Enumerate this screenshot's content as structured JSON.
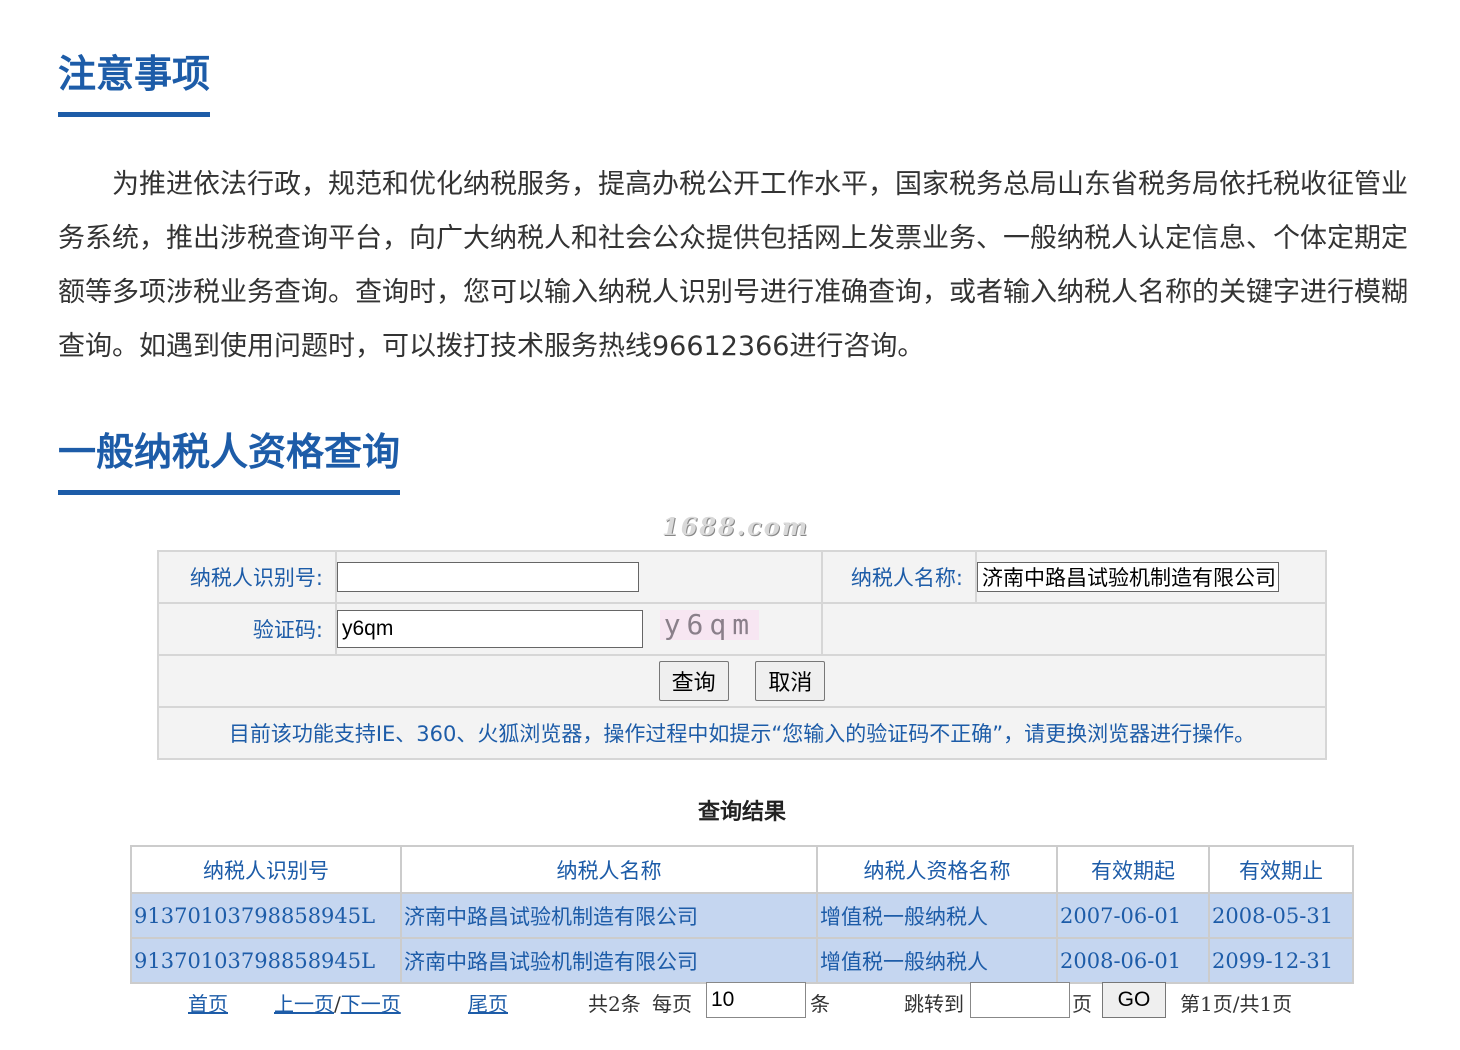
{
  "notice_section": {
    "title": "注意事项",
    "paragraph": "为推进依法行政，规范和优化纳税服务，提高办税公开工作水平，国家税务总局山东省税务局依托税收征管业务系统，推出涉税查询平台，向广大纳税人和社会公众提供包括网上发票业务、一般纳税人认定信息、个体定期定额等多项涉税业务查询。查询时，您可以输入纳税人识别号进行准确查询，或者输入纳税人名称的关键字进行模糊查询。如遇到使用问题时，可以拨打技术服务热线96612366进行咨询。"
  },
  "query_section": {
    "title": "一般纳税人资格查询",
    "watermark": "1688.com"
  },
  "form": {
    "taxpayer_id_label": "纳税人识别号:",
    "taxpayer_id_value": "",
    "taxpayer_name_label": "纳税人名称:",
    "taxpayer_name_value": "济南中路昌试验机制造有限公司",
    "captcha_label": "验证码:",
    "captcha_value": "y6qm",
    "captcha_image_text": "y6qm",
    "query_button": "查询",
    "cancel_button": "取消",
    "browser_notice": "目前该功能支持IE、360、火狐浏览器，操作过程中如提示“您输入的验证码不正确”，请更换浏览器进行操作。"
  },
  "results": {
    "title": "查询结果",
    "columns": [
      "纳税人识别号",
      "纳税人名称",
      "纳税人资格名称",
      "有效期起",
      "有效期止"
    ],
    "rows": [
      [
        "91370103798858945L",
        "济南中路昌试验机制造有限公司",
        "增值税一般纳税人",
        "2007-06-01",
        "2008-05-31"
      ],
      [
        "91370103798858945L",
        "济南中路昌试验机制造有限公司",
        "增值税一般纳税人",
        "2008-06-01",
        "2099-12-31"
      ]
    ]
  },
  "pager": {
    "first": "首页",
    "prev": "上一页",
    "sep": "/",
    "next": "下一页",
    "last": "尾页",
    "total": "共2条",
    "per_page_label": "每页",
    "per_page_value": "10",
    "per_page_unit": "条",
    "jump_label": "跳转到",
    "jump_value": "",
    "page_unit": "页",
    "go_button": "GO",
    "page_info": "第1页/共1页"
  },
  "colors": {
    "accent": "#1d5ca8",
    "row_bg": "#c5d6f0",
    "form_bg": "#f3f3f3"
  }
}
